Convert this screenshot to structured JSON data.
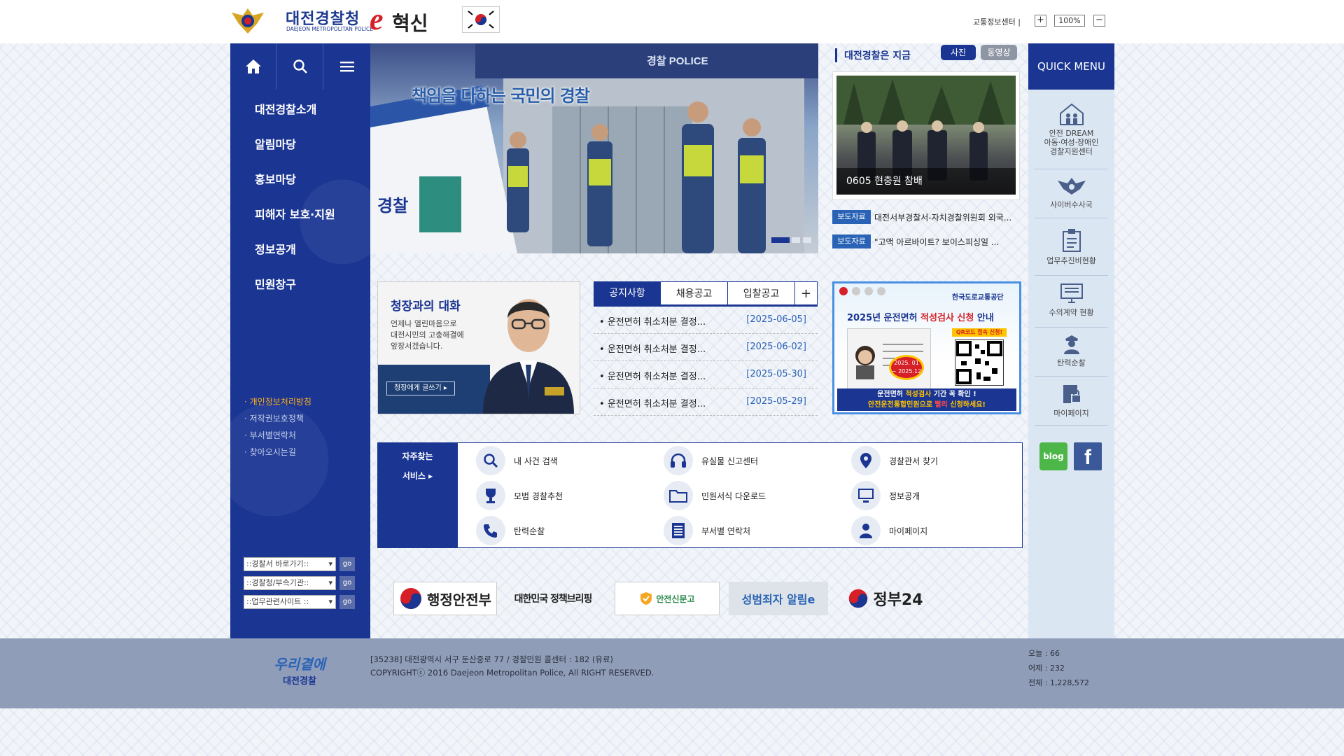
{
  "header": {
    "logo_title": "대전경찰청",
    "logo_subtitle": "DAEJEON METROPOLITAN POLICE",
    "logo_e": "e",
    "logo_innovation": "혁신",
    "traffic_center": "교통정보센터 |",
    "zoom_in": "+",
    "zoom_level": "100%",
    "zoom_out": "−"
  },
  "nav": {
    "icons": [
      "home-icon",
      "search-icon",
      "menu-icon"
    ],
    "menu": [
      "대전경찰소개",
      "알림마당",
      "홍보마당",
      "피해자 보호·지원",
      "정보공개",
      "민원창구"
    ],
    "policy_links": [
      "· 개인정보처리방침",
      "· 저작권보호정책",
      "· 부서별연락처",
      "· 찾아오시는길"
    ],
    "selects": [
      "::경찰서 바로가기::",
      "::경찰청/부속기관::",
      "::업무관련사이트 ::"
    ],
    "go": "go"
  },
  "banner": {
    "caption": "책임을 다하는 국민의 경찰",
    "door_sign": "경찰 POLICE",
    "car_text": "경찰"
  },
  "now": {
    "title": "대전경찰은 지금",
    "tab_photo": "사진",
    "tab_video": "동영상",
    "photo_caption": "0605 현충원 참배",
    "press": [
      {
        "badge": "보도자료",
        "text": "대전서부경찰서-자치경찰위원회 외국..."
      },
      {
        "badge": "보도자료",
        "text": "\"고액 아르바이트? 보이스피싱일 ..."
      }
    ]
  },
  "quick": {
    "title": "QUICK MENU",
    "items": [
      {
        "label": "안전 DREAM\n아동·여성·장애인\n경찰지원센터",
        "icon": "house-family-icon"
      },
      {
        "label": "사이버수사국",
        "icon": "police-eagle-icon"
      },
      {
        "label": "업무추진비현황",
        "icon": "clipboard-icon"
      },
      {
        "label": "수의계약 현황",
        "icon": "monitor-doc-icon"
      },
      {
        "label": "탄력순찰",
        "icon": "officer-icon"
      },
      {
        "label": "마이페이지",
        "icon": "lock-doc-icon"
      }
    ],
    "blog": "blog",
    "facebook": "f"
  },
  "chief": {
    "title": "청장과의 대화",
    "desc": [
      "언제나 열린마음으로",
      "대전시민의 고충해결에",
      "앞장서겠습니다."
    ],
    "button": "청장에게 글쓰기 ▸"
  },
  "notice": {
    "tabs": [
      "공지사항",
      "채용공고",
      "입찰공고"
    ],
    "more": "+",
    "rows": [
      {
        "title": "운전면허 취소처분 결정...",
        "date": "[2025-06-05]"
      },
      {
        "title": "운전면허 취소처분 결정...",
        "date": "[2025-06-02]"
      },
      {
        "title": "운전면허 취소처분 결정...",
        "date": "[2025-05-30]"
      },
      {
        "title": "운전면허 취소처분 결정...",
        "date": "[2025-05-29]"
      }
    ]
  },
  "license": {
    "org": "한국도로교통공단",
    "headline_pre": "2025년 운전면허 ",
    "headline_mid": "적성검사 신청",
    "headline_post": " 안내",
    "qr_label": "QR코드 접속 신청!",
    "period": "2025. 01 ~ 2025.12",
    "footer1_a": "운전면허 ",
    "footer1_b": "적성검사",
    "footer1_c": " 기간 꼭 확인 !",
    "footer2_a": "안전운전통합민원으로 ",
    "footer2_b": "빨리",
    "footer2_c": " 신청하세요!"
  },
  "services": {
    "label1": "자주찾는",
    "label2": "서비스 ▸",
    "items": [
      {
        "label": "내 사건 검색",
        "icon": "magnifier-icon"
      },
      {
        "label": "유실물 신고센터",
        "icon": "headset-icon"
      },
      {
        "label": "경찰관서 찾기",
        "icon": "location-pin-icon"
      },
      {
        "label": "모범 경찰추천",
        "icon": "trophy-icon"
      },
      {
        "label": "민원서식 다운로드",
        "icon": "folder-icon"
      },
      {
        "label": "정보공개",
        "icon": "monitor-icon"
      },
      {
        "label": "탄력순찰",
        "icon": "phone-icon"
      },
      {
        "label": "부서별 연락처",
        "icon": "list-icon"
      },
      {
        "label": "마이페이지",
        "icon": "person-icon"
      }
    ]
  },
  "partners": [
    "행정안전부",
    "대한민국 정책브리핑",
    "안전신문고",
    "성범죄자 알림e",
    "정부24"
  ],
  "footer": {
    "logo_line1": "우리곁에",
    "logo_line2": "대전경찰",
    "address": "[35238] 대전광역시 서구 둔산중로 77 / 경찰민원 콜센터 : 182 (유료)",
    "copyright": "COPYRIGHTⓒ 2016 Daejeon Metropolitan Police, All RIGHT RESERVED.",
    "today": "오늘 : 66",
    "yesterday": "어제 : 232",
    "total": "전체 : 1,228,572"
  },
  "colors": {
    "primary_navy": "#1a3592",
    "press_blue": "#2a63b6",
    "policy_orange": "#ffb020",
    "footer_gray": "#8f9db9"
  }
}
